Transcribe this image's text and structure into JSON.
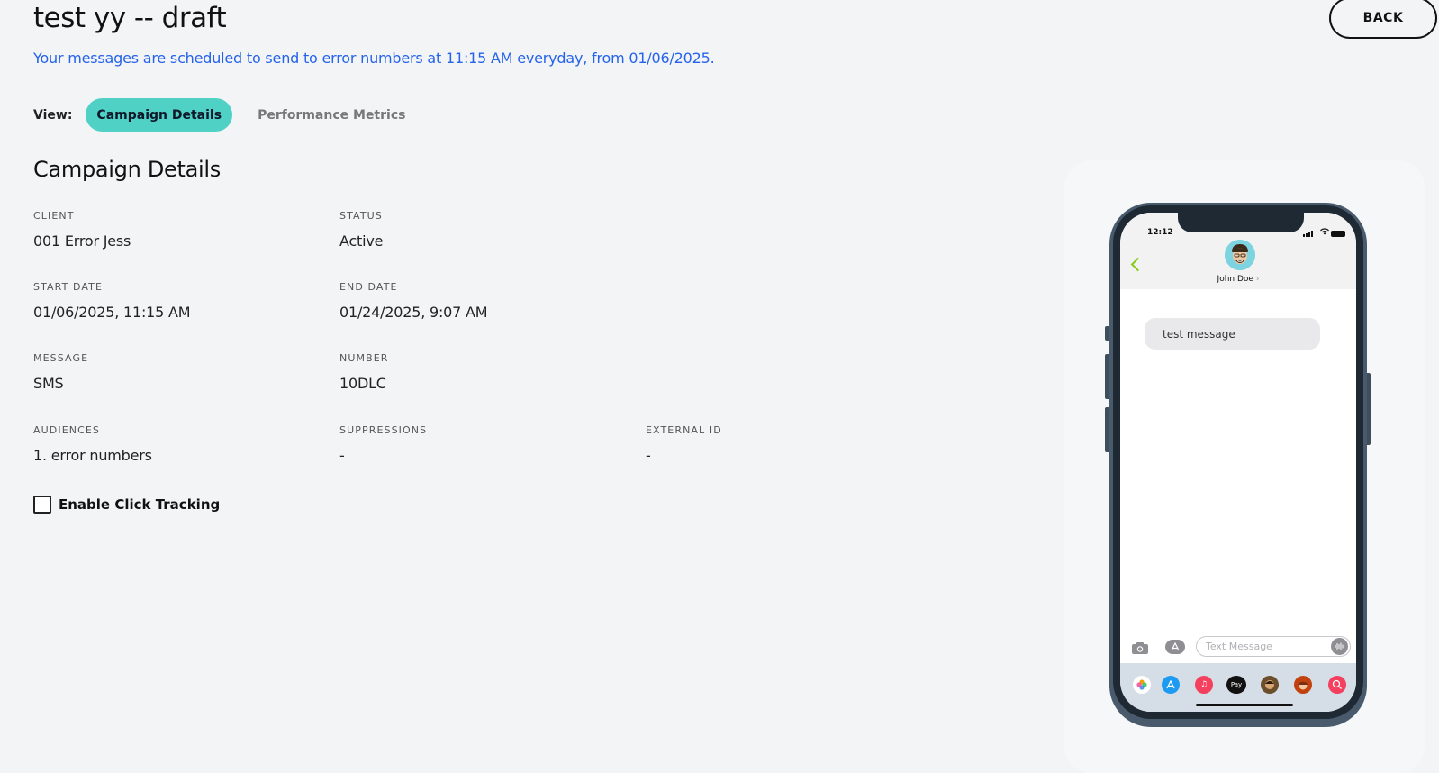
{
  "header": {
    "title": "test yy -- draft",
    "back_label": "BACK",
    "schedule_text": "Your messages are scheduled to send to error numbers at 11:15 AM everyday, from 01/06/2025."
  },
  "view": {
    "label": "View:",
    "tabs": [
      {
        "label": "Campaign Details",
        "active": true
      },
      {
        "label": "Performance Metrics",
        "active": false
      }
    ]
  },
  "details": {
    "section_title": "Campaign Details",
    "client": {
      "label": "CLIENT",
      "value": "001 Error Jess"
    },
    "status": {
      "label": "STATUS",
      "value": "Active"
    },
    "start_date": {
      "label": "START DATE",
      "value": "01/06/2025, 11:15 AM"
    },
    "end_date": {
      "label": "END DATE",
      "value": "01/24/2025, 9:07 AM"
    },
    "message": {
      "label": "MESSAGE",
      "value": "SMS"
    },
    "number": {
      "label": "NUMBER",
      "value": "10DLC"
    },
    "audiences": {
      "label": "AUDIENCES",
      "value": "1. error numbers"
    },
    "suppressions": {
      "label": "SUPPRESSIONS",
      "value": "-"
    },
    "external_id": {
      "label": "EXTERNAL ID",
      "value": "-"
    }
  },
  "click_tracking": {
    "label": "Enable Click Tracking",
    "checked": false
  },
  "phone_preview": {
    "time": "12:12",
    "contact_name": "John Doe",
    "message": "test message",
    "input_placeholder": "Text Message",
    "apps": [
      "photos-icon",
      "app-store-icon",
      "music-icon",
      "apple-pay-icon",
      "memoji-icon",
      "memoji-icon",
      "search-globe-icon"
    ]
  },
  "colors": {
    "accent_teal": "#4fd1c5",
    "link_blue": "#2563eb",
    "back_chevron_green": "#84cc16"
  }
}
